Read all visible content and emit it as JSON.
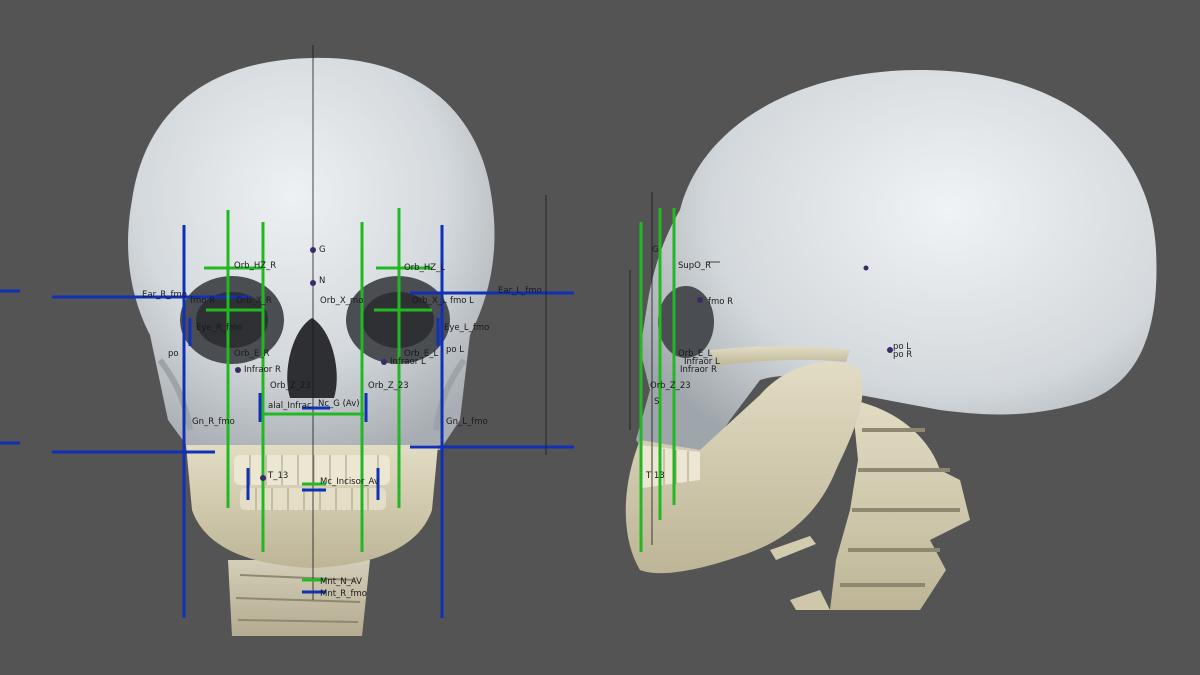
{
  "scene": {
    "background_color": "#545454",
    "skull_color": "#d9dee2",
    "mandible_color": "#d9d3b8",
    "guide_colors": {
      "blue": "#1030b8",
      "green": "#22b822"
    }
  },
  "frontal_view": {
    "labels": {
      "g": "G",
      "n": "N",
      "orb_hz_r": "Orb_HZ_R",
      "orb_hz_l": "Orb_HZ_L",
      "ear_r_fmo": "Ear_R_fmo",
      "ear_l_fmo": "Ear_L_fmo",
      "fmo_r": "fmo R",
      "fmo_l": "fmo L",
      "orb_x_r": "Orb_X_R",
      "orb_x_l": "Orb_X_L",
      "orb_x_mid": "Orb_X_mo",
      "eye_r_fmo": "Eye_R_fmo",
      "eye_l_fmo": "Eye_L_fmo",
      "po_r": "po",
      "po_l": "po L",
      "orb_e_r": "Orb_E_R",
      "orb_e_l": "Orb_E_L",
      "infraor_r": "Infraor R",
      "infraor_l": "Infraor L",
      "orb_z_r": "Orb_Z_23",
      "orb_z_l": "Orb_Z_23",
      "alar": "alal_Infrac",
      "nose": "Nc_G (Av)",
      "gn_r": "Gn_R_fmo",
      "gn_l": "Gn_L_fmo",
      "t13": "T_13",
      "mouth": "Mc_Incisor_Av",
      "mental": "Mnt_N_AV",
      "mental_r": "Mnt_R_fmo"
    }
  },
  "lateral_view": {
    "labels": {
      "g": "G",
      "supo": "SupO_R",
      "fmo": "fmo R",
      "orb": "Orb_E_L",
      "infraor": "Infraor L",
      "infraor2": "Infraor R",
      "orb_z": "Orb_Z_23",
      "po": "po L",
      "po2": "po R",
      "s": "S",
      "t": "T 13"
    }
  }
}
